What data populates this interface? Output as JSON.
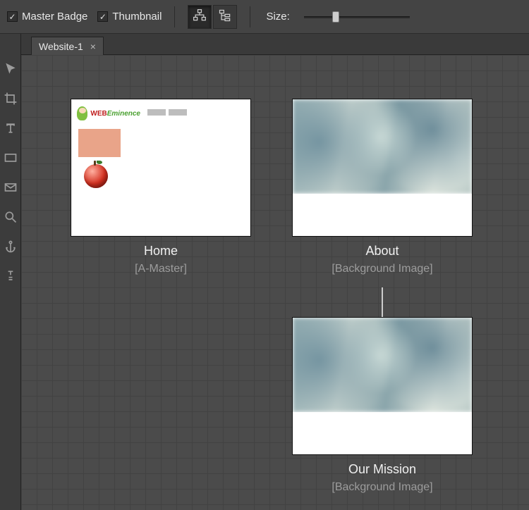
{
  "options": {
    "master_badge_label": "Master Badge",
    "master_badge_checked": true,
    "thumbnail_label": "Thumbnail",
    "thumbnail_checked": true,
    "size_label": "Size:"
  },
  "tab": {
    "label": "Website-1",
    "close_glyph": "×"
  },
  "pages": {
    "home": {
      "title": "Home",
      "master": "[A-Master]",
      "logo_text_a": "WEB",
      "logo_text_b": "Eminence"
    },
    "about": {
      "title": "About",
      "master": "[Background Image]"
    },
    "mission": {
      "title": "Our Mission",
      "master": "[Background Image]"
    }
  },
  "checkmark_glyph": "✓"
}
